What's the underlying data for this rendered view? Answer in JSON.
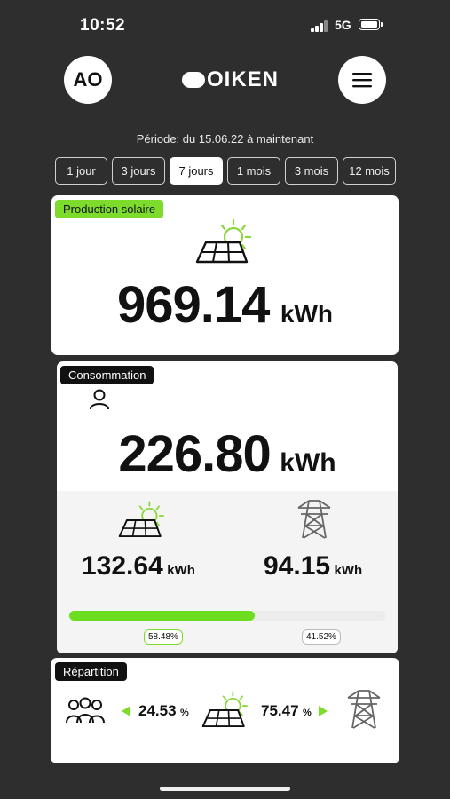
{
  "status_bar": {
    "time": "10:52",
    "network": "5G",
    "battery": "full"
  },
  "header": {
    "avatar_initials": "AO",
    "logo_text": "OIKEN"
  },
  "period_text": "Période: du 15.06.22 à maintenant",
  "tabs": [
    {
      "label": "1 jour",
      "active": false
    },
    {
      "label": "3 jours",
      "active": false
    },
    {
      "label": "7 jours",
      "active": true
    },
    {
      "label": "1 mois",
      "active": false
    },
    {
      "label": "3 mois",
      "active": false
    },
    {
      "label": "12 mois",
      "active": false
    }
  ],
  "production": {
    "label": "Production solaire",
    "value": "969.14",
    "unit": "kWh"
  },
  "consumption": {
    "label": "Consommation",
    "value": "226.80",
    "unit": "kWh",
    "solar": {
      "value": "132.64",
      "unit": "kWh"
    },
    "grid": {
      "value": "94.15",
      "unit": "kWh"
    },
    "solar_pct_label": "58.48%",
    "grid_pct_label": "41.52%",
    "solar_fraction": 0.5848
  },
  "repartition": {
    "label": "Répartition",
    "left_value": "24.53",
    "left_unit": "%",
    "right_value": "75.47",
    "right_unit": "%"
  },
  "colors": {
    "accent": "#7ddb2b",
    "background": "#2e2e2e",
    "card": "#ffffff"
  }
}
